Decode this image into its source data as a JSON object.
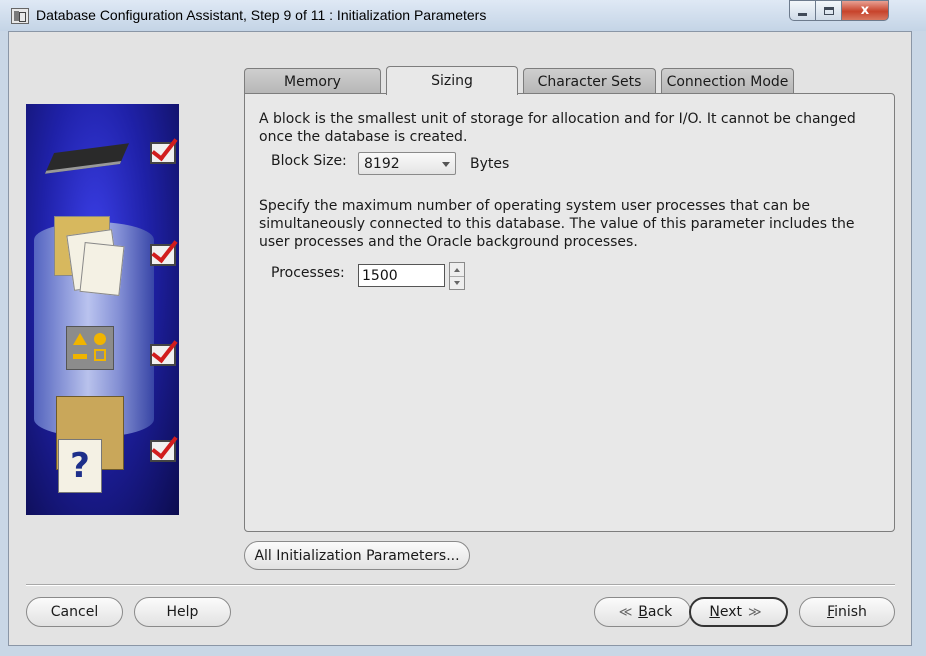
{
  "window": {
    "title": "Database Configuration Assistant, Step 9 of 11 : Initialization Parameters",
    "close_label": "x"
  },
  "tabs": [
    {
      "label": "Memory",
      "active": false
    },
    {
      "label": "Sizing",
      "active": true
    },
    {
      "label": "Character Sets",
      "active": false
    },
    {
      "label": "Connection Mode",
      "active": false
    }
  ],
  "sizing": {
    "block_description": "A block is the smallest unit of storage for allocation and for I/O. It cannot be changed once the database is created.",
    "block_size_label": "Block Size:",
    "block_size_value": "8192",
    "block_size_unit": "Bytes",
    "processes_description": "Specify the maximum number of operating system user processes that can be simultaneously connected to this database. The value of this parameter includes the user processes and the Oracle background processes.",
    "processes_label": "Processes:",
    "processes_value": "1500"
  },
  "buttons": {
    "all_params": "All Initialization Parameters...",
    "cancel": "Cancel",
    "help": "Help",
    "back_prefix": "",
    "back_mnemonic": "B",
    "back_rest": "ack",
    "next_mnemonic": "N",
    "next_rest": "ext",
    "finish_mnemonic": "F",
    "finish_rest": "inish"
  },
  "side_panel": {
    "question_glyph": "?",
    "icons": [
      "memory-chip-icon",
      "documents-icon",
      "shapes-icon",
      "help-documents-icon"
    ],
    "checked_steps": 4
  }
}
